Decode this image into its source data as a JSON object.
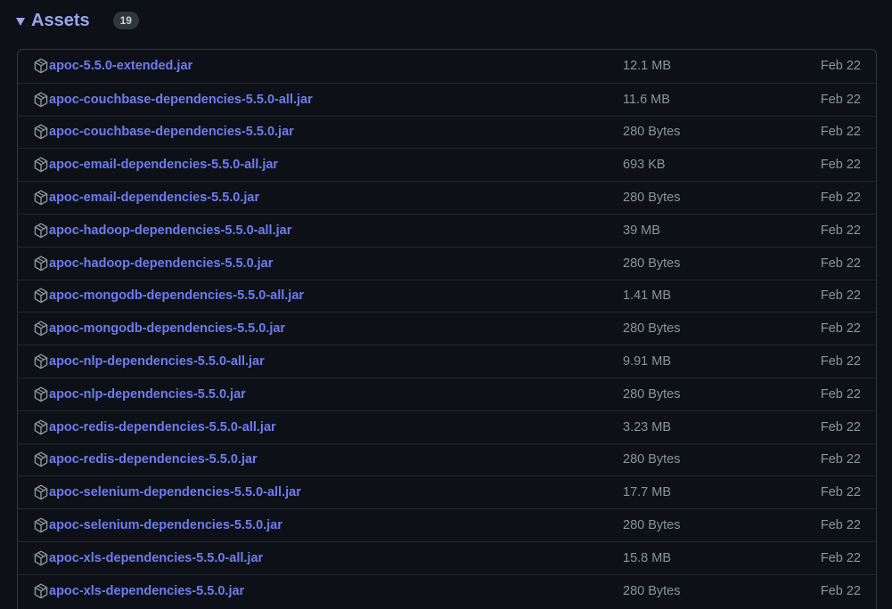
{
  "assets": {
    "title": "Assets",
    "count": "19",
    "items": [
      {
        "name": "apoc-5.5.0-extended.jar",
        "size": "12.1 MB",
        "date": "Feb 22"
      },
      {
        "name": "apoc-couchbase-dependencies-5.5.0-all.jar",
        "size": "11.6 MB",
        "date": "Feb 22"
      },
      {
        "name": "apoc-couchbase-dependencies-5.5.0.jar",
        "size": "280 Bytes",
        "date": "Feb 22"
      },
      {
        "name": "apoc-email-dependencies-5.5.0-all.jar",
        "size": "693 KB",
        "date": "Feb 22"
      },
      {
        "name": "apoc-email-dependencies-5.5.0.jar",
        "size": "280 Bytes",
        "date": "Feb 22"
      },
      {
        "name": "apoc-hadoop-dependencies-5.5.0-all.jar",
        "size": "39 MB",
        "date": "Feb 22"
      },
      {
        "name": "apoc-hadoop-dependencies-5.5.0.jar",
        "size": "280 Bytes",
        "date": "Feb 22"
      },
      {
        "name": "apoc-mongodb-dependencies-5.5.0-all.jar",
        "size": "1.41 MB",
        "date": "Feb 22"
      },
      {
        "name": "apoc-mongodb-dependencies-5.5.0.jar",
        "size": "280 Bytes",
        "date": "Feb 22"
      },
      {
        "name": "apoc-nlp-dependencies-5.5.0-all.jar",
        "size": "9.91 MB",
        "date": "Feb 22"
      },
      {
        "name": "apoc-nlp-dependencies-5.5.0.jar",
        "size": "280 Bytes",
        "date": "Feb 22"
      },
      {
        "name": "apoc-redis-dependencies-5.5.0-all.jar",
        "size": "3.23 MB",
        "date": "Feb 22"
      },
      {
        "name": "apoc-redis-dependencies-5.5.0.jar",
        "size": "280 Bytes",
        "date": "Feb 22"
      },
      {
        "name": "apoc-selenium-dependencies-5.5.0-all.jar",
        "size": "17.7 MB",
        "date": "Feb 22"
      },
      {
        "name": "apoc-selenium-dependencies-5.5.0.jar",
        "size": "280 Bytes",
        "date": "Feb 22"
      },
      {
        "name": "apoc-xls-dependencies-5.5.0-all.jar",
        "size": "15.8 MB",
        "date": "Feb 22"
      },
      {
        "name": "apoc-xls-dependencies-5.5.0.jar",
        "size": "280 Bytes",
        "date": "Feb 22"
      }
    ]
  },
  "icons": {
    "row": "package-icon",
    "toggle": "caret-down-icon"
  },
  "colors": {
    "background": "#0d1117",
    "link": "#6e7cf0",
    "title": "#9aa5f0",
    "muted": "#8b949e",
    "border": "#30363d"
  }
}
